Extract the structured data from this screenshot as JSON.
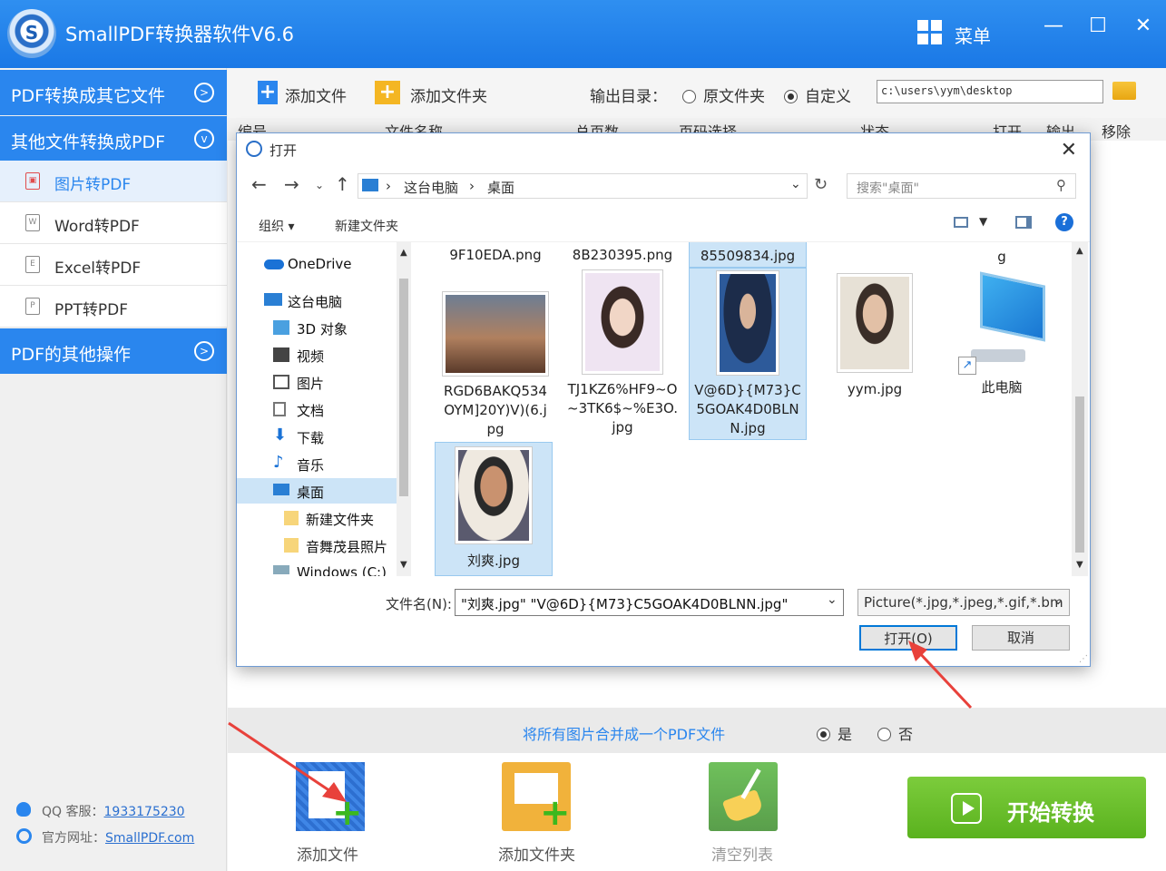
{
  "app": {
    "title": "SmallPDF转换器软件V6.6",
    "logo_letter": "S",
    "menu_label": "菜单",
    "min": "—",
    "max": "☐",
    "close": "✕"
  },
  "sidebar": {
    "sec1": "PDF转换成其它文件",
    "sec2": "其他文件转换成PDF",
    "items": [
      {
        "label": "图片转PDF",
        "icon": "image-file-icon"
      },
      {
        "label": "Word转PDF",
        "icon": "word-file-icon"
      },
      {
        "label": "Excel转PDF",
        "icon": "excel-file-icon"
      },
      {
        "label": "PPT转PDF",
        "icon": "ppt-file-icon"
      }
    ],
    "sec3": "PDF的其他操作",
    "qq_label": "QQ 客服：",
    "qq_value": "1933175230",
    "site_label": "官方网址：",
    "site_value": "SmallPDF.com"
  },
  "toolbar": {
    "add_file": "添加文件",
    "add_folder": "添加文件夹",
    "output_label": "输出目录：",
    "opt_original": "原文件夹",
    "opt_custom": "自定义",
    "output_path": "c:\\users\\yym\\desktop"
  },
  "columns": [
    "编号",
    "文件名称",
    "总页数",
    "页码选择",
    "状态",
    "打开",
    "输出",
    "移除"
  ],
  "merge": {
    "label": "将所有图片合并成一个PDF文件",
    "yes": "是",
    "no": "否"
  },
  "bottom": {
    "add_file": "添加文件",
    "add_folder": "添加文件夹",
    "clear": "清空列表",
    "start": "开始转换"
  },
  "dialog": {
    "title": "打开",
    "path": [
      "这台电脑",
      "桌面"
    ],
    "search_placeholder": "搜索\"桌面\"",
    "organize": "组织 ▾",
    "new_folder": "新建文件夹",
    "tree": [
      "OneDrive",
      "这台电脑",
      "3D 对象",
      "视频",
      "图片",
      "文档",
      "下载",
      "音乐",
      "桌面",
      "新建文件夹",
      "音舞茂县照片",
      "Windows (C:)"
    ],
    "top_labels": [
      "9F10EDA.png",
      "8B230395.png",
      "85509834.jpg",
      "g"
    ],
    "files": [
      {
        "name": "RGD6BAKQ534OYM]20Y)V)(6.jpg"
      },
      {
        "name": "TJ1KZ6%HF9~O~3TK6$~%E3O.jpg"
      },
      {
        "name": "V@6D}{M73}C5GOAK4D0BLNN.jpg"
      },
      {
        "name": "yym.jpg"
      },
      {
        "name": "此电脑"
      },
      {
        "name": "刘爽.jpg"
      }
    ],
    "filename_label": "文件名(N):",
    "filename_value": "\"刘爽.jpg\" \"V@6D}{M73}C5GOAK4D0BLNN.jpg\"",
    "filetype": "Picture(*.jpg,*.jpeg,*.gif,*.bm",
    "open": "打开(O)",
    "cancel": "取消"
  },
  "colors": {
    "brand": "#2a86ee",
    "start_green": "#5ab21e",
    "annotation_red": "#e8413b"
  }
}
